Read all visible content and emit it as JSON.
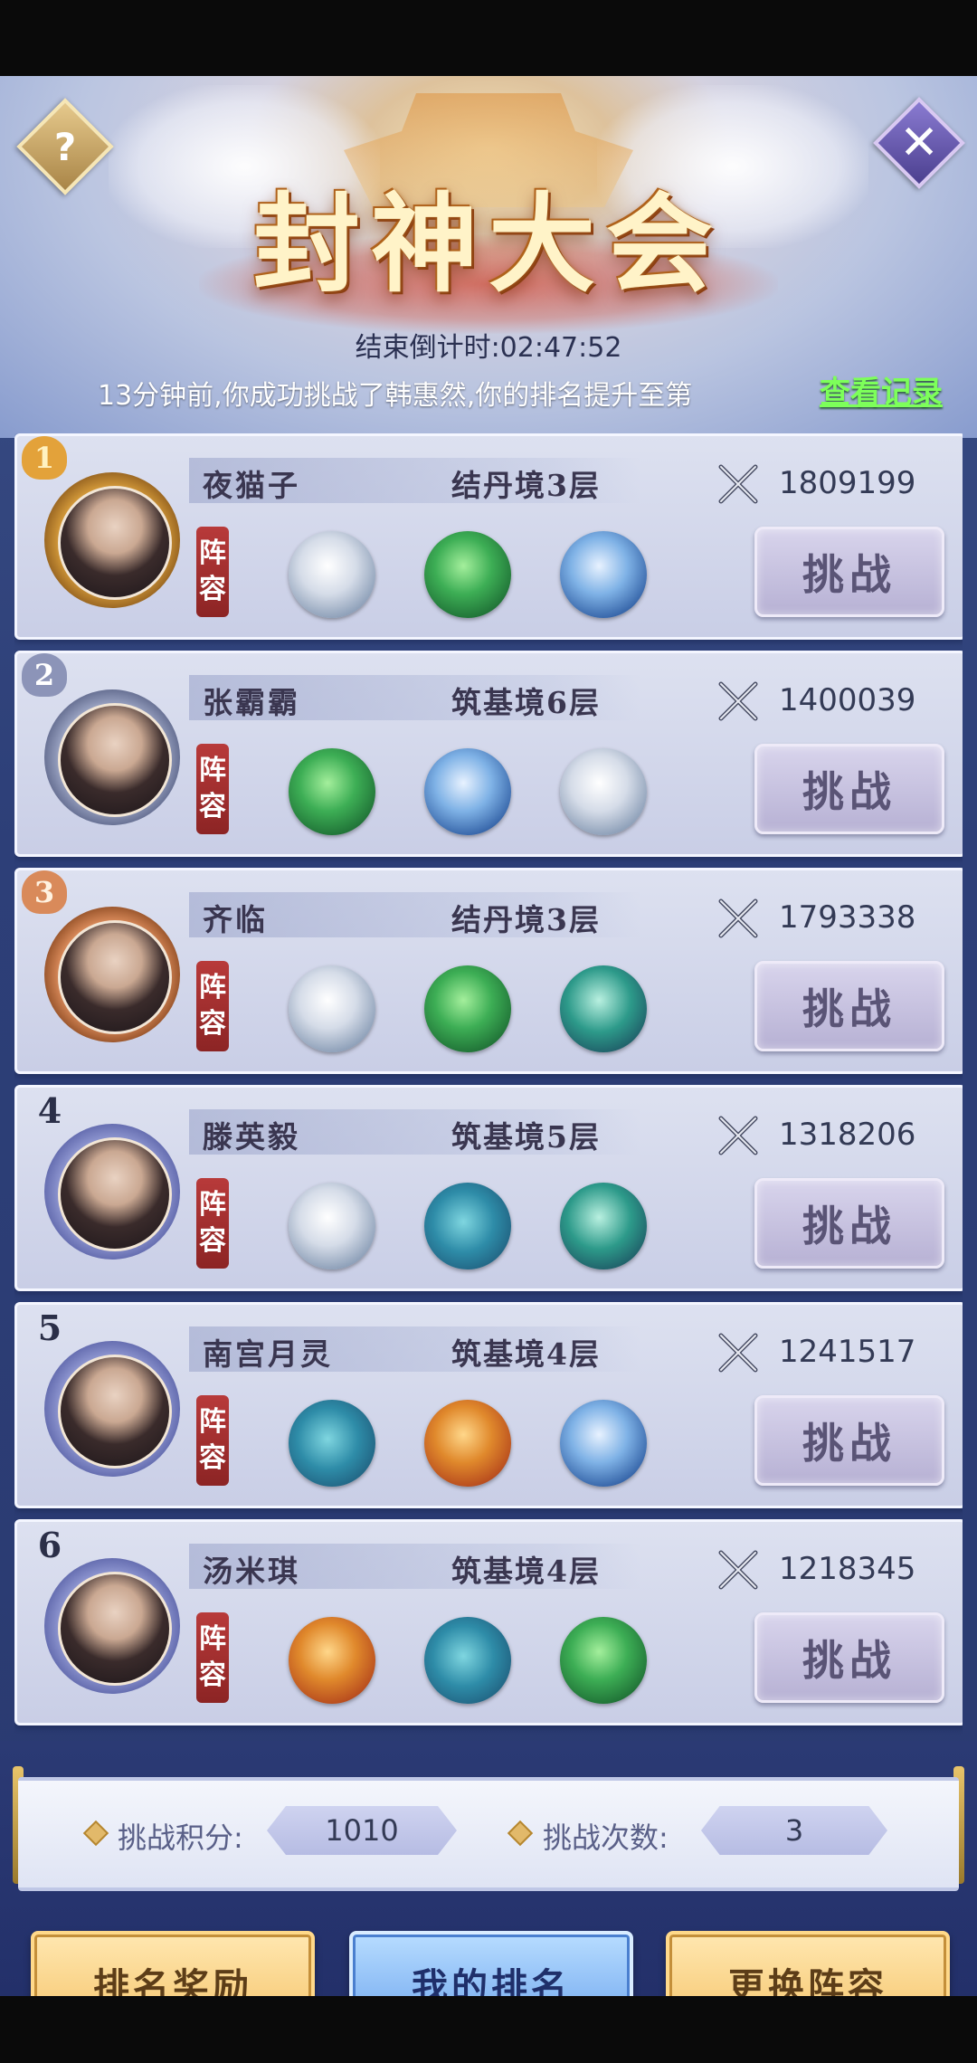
{
  "header": {
    "title": "封神大会",
    "countdown": "结束倒计时:02:47:52",
    "notice": "13分钟前,你成功挑战了韩惠然,你的排名提升至第",
    "view_log_label": "查看记录",
    "help_label": "?",
    "close_label": "✕"
  },
  "lineup_tag": [
    "阵",
    "容"
  ],
  "challenge_label": "挑战",
  "players": [
    {
      "rank": "1",
      "name": "夜猫子",
      "realm": "结丹境3层",
      "power": "1809199",
      "pets": [
        "white-tiger-icon",
        "green-dragon-icon",
        "blue-dragon-icon"
      ]
    },
    {
      "rank": "2",
      "name": "张霸霸",
      "realm": "筑基境6层",
      "power": "1400039",
      "pets": [
        "green-dragon-icon",
        "blue-dragon-icon",
        "white-tiger-icon"
      ]
    },
    {
      "rank": "3",
      "name": "齐临",
      "realm": "结丹境3层",
      "power": "1793338",
      "pets": [
        "white-tiger-icon",
        "green-dragon-icon",
        "teal-dragon-icon"
      ]
    },
    {
      "rank": "4",
      "name": "滕英毅",
      "realm": "筑基境5层",
      "power": "1318206",
      "pets": [
        "white-tiger-icon",
        "blue-whale-icon",
        "horned-beast-icon"
      ]
    },
    {
      "rank": "5",
      "name": "南宫月灵",
      "realm": "筑基境4层",
      "power": "1241517",
      "pets": [
        "blue-whale-icon",
        "golden-dragon-icon",
        "blue-dragon-icon"
      ]
    },
    {
      "rank": "6",
      "name": "汤米琪",
      "realm": "筑基境4层",
      "power": "1218345",
      "pets": [
        "golden-dragon-icon",
        "blue-whale-icon",
        "green-dragon-icon"
      ]
    }
  ],
  "stats": {
    "points_label": "挑战积分:",
    "points_value": "1010",
    "attempts_label": "挑战次数:",
    "attempts_value": "3"
  },
  "actions": {
    "rank_reward": "排名奖励",
    "my_rank": "我的排名",
    "change_lineup": "更换阵容"
  },
  "colors": {
    "background": "#2d3f78",
    "card": "#d3d8ec",
    "view_log": "#7dff5a",
    "rank_gold": "#e3a23a",
    "rank_silver": "#9aa3c2",
    "rank_bronze": "#d98a5a"
  }
}
